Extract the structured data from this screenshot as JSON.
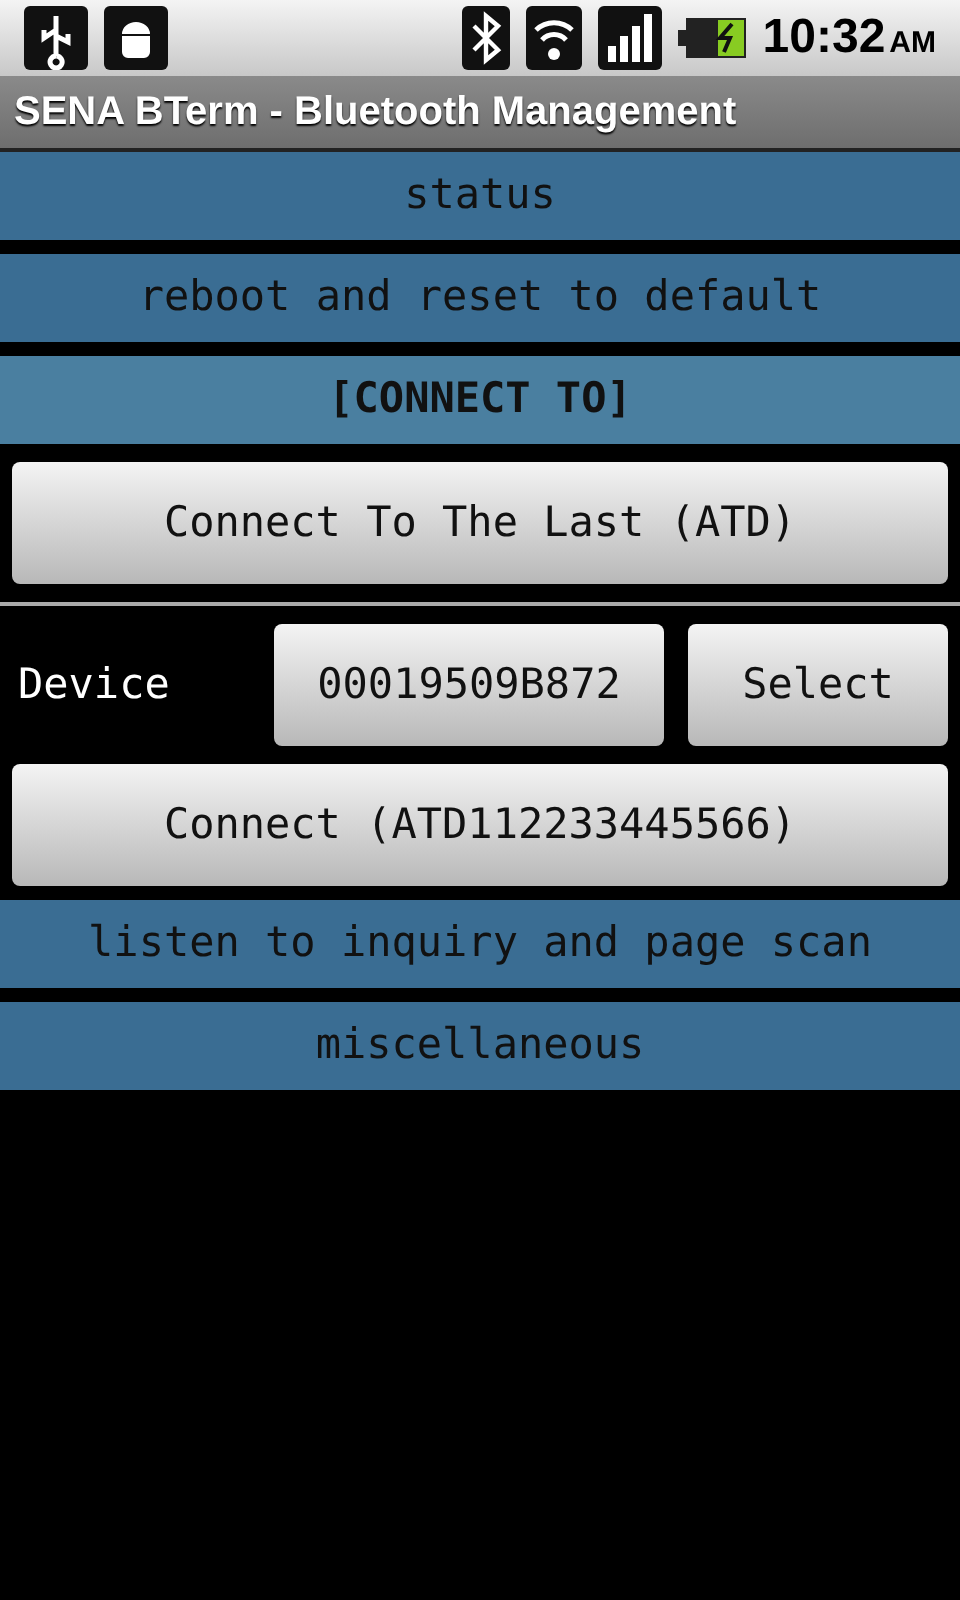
{
  "status_bar": {
    "time": "10:32",
    "ampm": "AM"
  },
  "window": {
    "title": "SENA BTerm - Bluetooth Management"
  },
  "sections": [
    {
      "label": "status",
      "expanded": false
    },
    {
      "label": "reboot and reset to default",
      "expanded": false
    },
    {
      "label": "[CONNECT TO]",
      "expanded": true,
      "items": [
        {
          "kind": "button",
          "label": "Connect To The Last (ATD)"
        },
        {
          "kind": "divider"
        },
        {
          "kind": "device_row",
          "label": "Device",
          "address": "00019509B872",
          "button": "Select"
        },
        {
          "kind": "button",
          "label": "Connect (ATD112233445566)"
        }
      ]
    },
    {
      "label": "listen to inquiry and page scan",
      "expanded": false
    },
    {
      "label": "miscellaneous",
      "expanded": false
    }
  ]
}
